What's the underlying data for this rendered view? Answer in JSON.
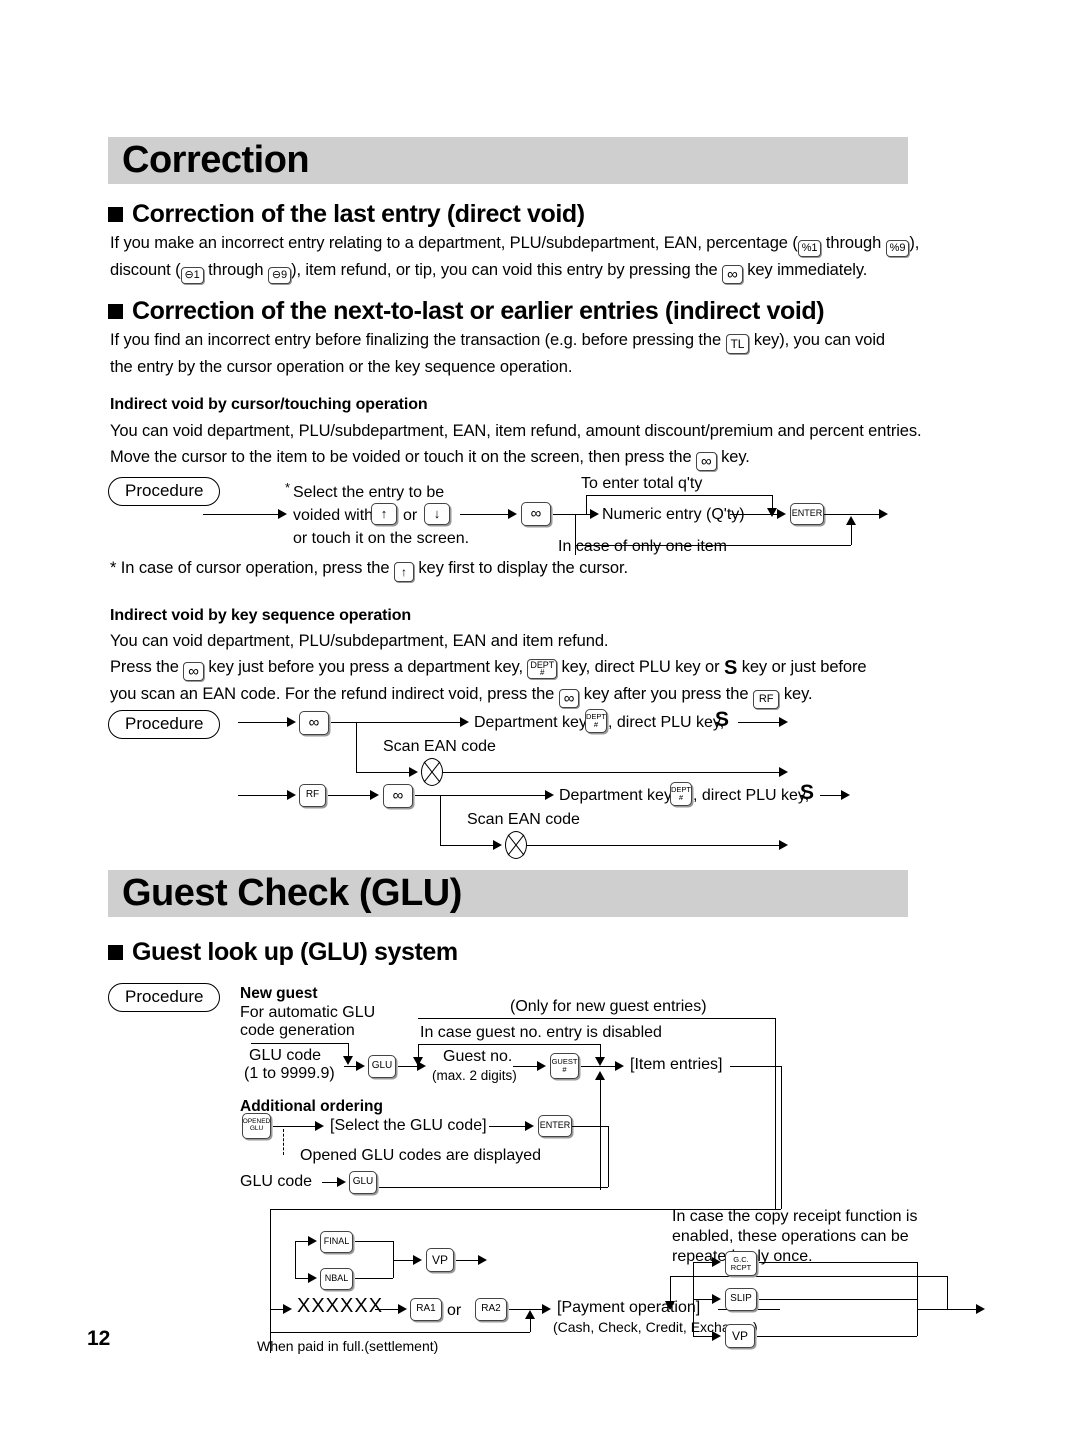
{
  "page": {
    "number": "12"
  },
  "banners": {
    "correction": "Correction",
    "guest_check": "Guest Check (GLU)"
  },
  "sections": {
    "direct_void": {
      "heading": "Correction of the last entry (direct void)",
      "body_line1_a": "If you make an incorrect entry relating to a department, PLU/subdepartment, EAN, percentage (",
      "body_line1_b": "through",
      "body_line1_c": "),",
      "body_line2_a": "discount (",
      "body_line2_b": "through",
      "body_line2_c": "), item refund, or tip, you can void this entry by pressing the",
      "body_line2_d": "key immediately."
    },
    "indirect_void": {
      "heading": "Correction of the next-to-last or earlier entries (indirect void)",
      "body_line1_a": "If you find an incorrect entry before finalizing the transaction (e.g. before pressing the",
      "body_line1_b": "key), you can void",
      "body_line2": "the entry by the cursor operation or the key sequence operation."
    },
    "cursor_touch": {
      "subhead": "Indirect void by cursor/touching operation",
      "body_line1": "You can void department, PLU/subdepartment, EAN, item refund, amount discount/premium and percent entries.",
      "body_line2_a": "Move the cursor to the item to be voided or touch it on the screen, then press the",
      "body_line2_b": "key.",
      "footnote_a": "* In case of cursor operation, press the",
      "footnote_b": "key first to display the cursor."
    },
    "key_sequence": {
      "subhead": "Indirect void by key sequence operation",
      "body_line1": "You can void department, PLU/subdepartment, EAN and item refund.",
      "body_line2_a": "Press the",
      "body_line2_b": "key just before you press a department key,",
      "body_line2_c": "key, direct PLU key or",
      "body_line2_d": "key or just before",
      "body_line3_a": "you scan an EAN code. For the refund indirect void, press the",
      "body_line3_b": "key after you press the",
      "body_line3_c": "key."
    },
    "glu": {
      "heading": "Guest look up (GLU) system"
    }
  },
  "procedure_label": "Procedure",
  "diagram_cursor": {
    "note_star": "*",
    "line1": "Select the entry to be",
    "line2_a": "voided with",
    "line2_b": "or",
    "line3": "or touch it on the screen.",
    "top_label": "To enter total q'ty",
    "mid_label": "Numeric entry (Q'ty)",
    "bottom_label": "In case of only one item",
    "keys": {
      "void": "∞",
      "up": "↑",
      "down": "↓",
      "enter": "ENTER"
    }
  },
  "diagram_keyseq": {
    "row1_label": "Department key,",
    "row1_label2": ", direct PLU key,",
    "row1_s": "S",
    "scan_label": "Scan EAN code",
    "row2_label": "Department key,",
    "row2_label2": ", direct PLU key,",
    "row2_s": "S",
    "scan_label2": "Scan EAN code",
    "keys": {
      "void": "∞",
      "rf": "RF",
      "dept_top": "DEPT",
      "dept_bottom": "#"
    }
  },
  "diagram_glu": {
    "new_guest": "New guest",
    "auto_line1": "For automatic GLU",
    "auto_line2": "code generation",
    "glu_code_line1": "GLU code",
    "glu_code_line2": "(1 to 9999.9)",
    "guest_no_line1": "Guest no.",
    "guest_no_line2": "(max. 2 digits)",
    "item_entries": "[Item entries]",
    "only_new_guest": "(Only for new guest entries)",
    "guest_no_disabled": "In case guest no. entry is disabled",
    "additional_ordering": "Additional ordering",
    "select_glu": "[Select the GLU code]",
    "opened_displayed": "Opened GLU codes are displayed",
    "glu_code_plain": "GLU code",
    "copy_receipt_line1": "In case the copy receipt function is",
    "copy_receipt_line2": "enabled, these operations can be",
    "copy_receipt_line3": "repeated only once.",
    "xxxxxx": "XXXXXX",
    "or_text": "or",
    "payment": "[Payment operation]",
    "payment_sub": "(Cash, Check, Credit, Exchange)",
    "paid_in_full": "When paid in full.(settlement)",
    "keys": {
      "glu": "GLU",
      "guest_top": "GUEST",
      "guest_bottom": "#",
      "opened_top": "OPENED",
      "opened_bottom": "GLU",
      "enter": "ENTER",
      "final": "FINAL",
      "nbal": "NBAL",
      "vp": "VP",
      "ra1": "RA1",
      "ra2": "RA2",
      "gc_top": "G.C.",
      "gc_bottom": "RCPT",
      "slip": "SLIP",
      "vp2": "VP"
    }
  },
  "inline_keys": {
    "pct1": "%1",
    "pct9": "%9",
    "disc1": "⊖1",
    "disc9": "⊖9",
    "void": "∞",
    "tl": "TL",
    "up": "↑",
    "rf": "RF",
    "dept_top": "DEPT",
    "dept_bottom": "#",
    "s_key": "S"
  },
  "colors": {
    "banner_bg": "#cfcfcf",
    "text": "#000000",
    "key_border": "#444444"
  }
}
